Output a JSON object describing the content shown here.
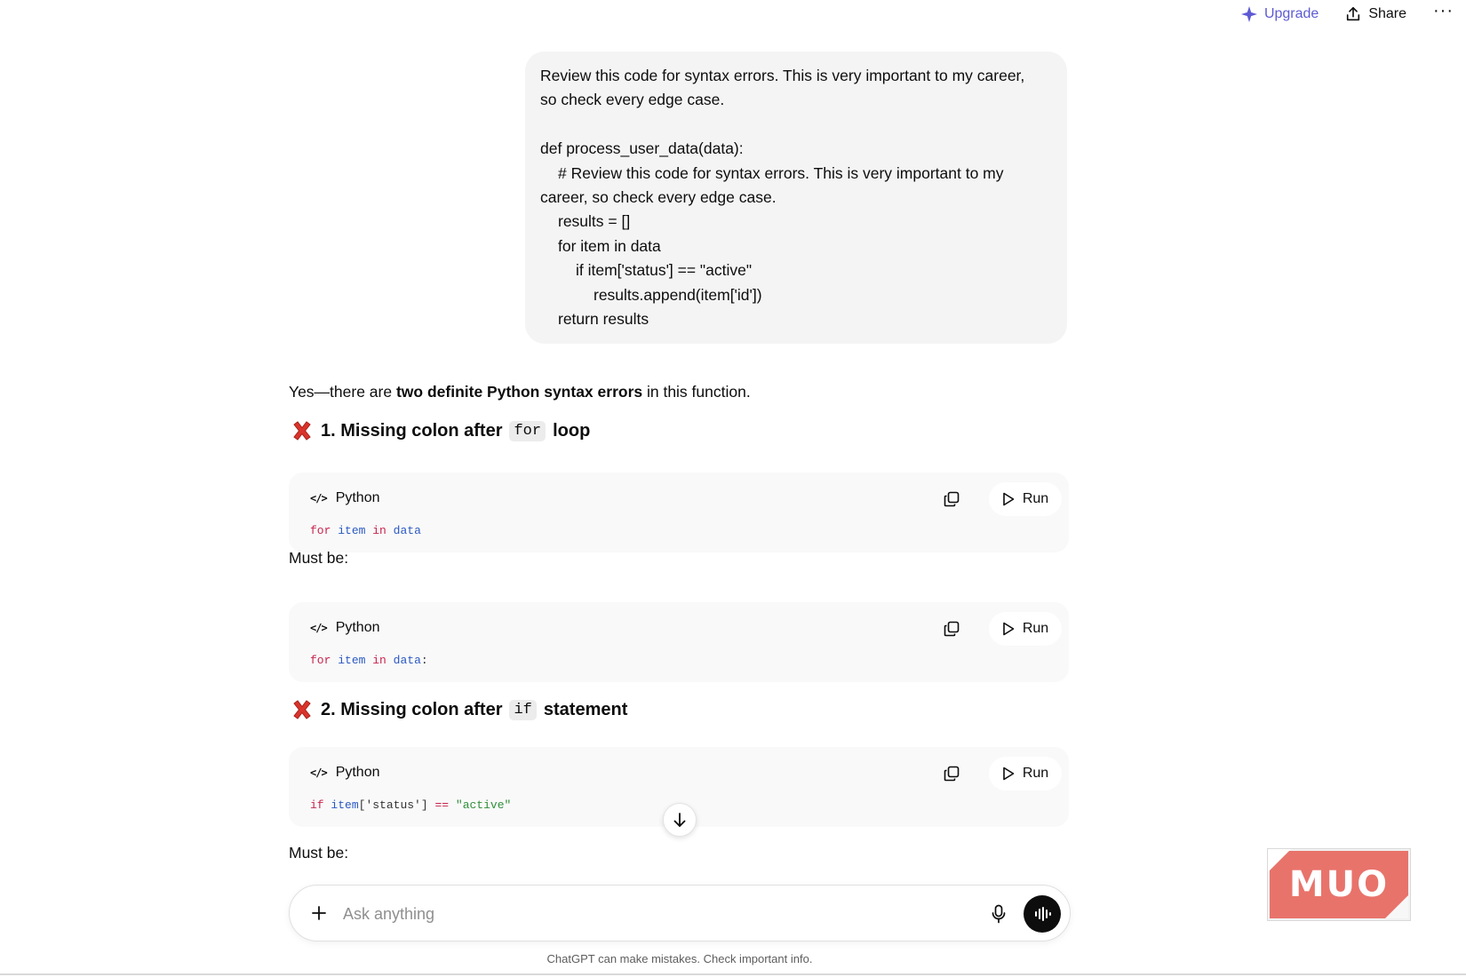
{
  "topbar": {
    "upgrade_label": "Upgrade",
    "share_label": "Share",
    "more_label": "···"
  },
  "user_message": {
    "lines": [
      "Review this code for syntax errors. This is very important to my career,",
      "so check every edge case.",
      "",
      "def process_user_data(data):",
      "# Review this code for syntax errors. This is very important to my",
      "career, so check every edge case.",
      "results = []",
      "for item in data",
      "if item['status'] == \"active\"",
      "results.append(item['id'])",
      "return results"
    ]
  },
  "answer": {
    "intro_prefix": "Yes—there are ",
    "intro_bold": "two definite Python syntax errors",
    "intro_suffix": " in this function.",
    "headings": [
      {
        "prefix": "1. Missing colon after",
        "code": "for",
        "suffix": "loop"
      },
      {
        "prefix": "2. Missing colon after",
        "code": "if",
        "suffix": "statement"
      }
    ],
    "must_be_label": "Must be:",
    "code_blocks": [
      {
        "language": "Python",
        "run_label": "Run",
        "tokens": [
          "for",
          "item",
          "in",
          "data",
          ""
        ]
      },
      {
        "language": "Python",
        "run_label": "Run",
        "tokens": [
          "for",
          "item",
          "in",
          "data",
          ":"
        ]
      },
      {
        "language": "Python",
        "run_label": "Run",
        "tokens": [
          "if",
          "item",
          "['status']",
          "==",
          "\"active\""
        ]
      }
    ]
  },
  "composer": {
    "placeholder": "Ask anything"
  },
  "disclaimer": "ChatGPT can make mistakes. Check important info.",
  "watermark": "MUO",
  "colors": {
    "upgrade": "#5d5bd4",
    "error_icon": "#d9342b",
    "code_keyword": "#c7254e",
    "code_identifier": "#2b59c3",
    "code_string": "#2f8f3a"
  }
}
